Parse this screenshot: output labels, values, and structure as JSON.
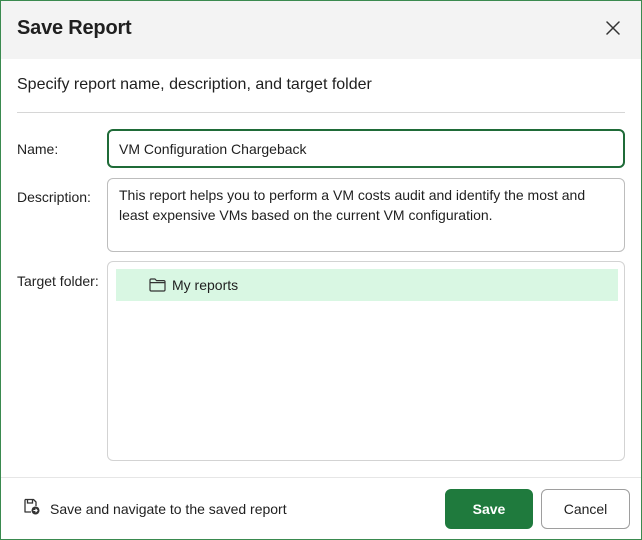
{
  "dialog": {
    "title": "Save Report",
    "subtitle": "Specify report name, description, and target folder"
  },
  "form": {
    "name_label": "Name:",
    "name_value": "VM Configuration Chargeback",
    "description_label": "Description:",
    "description_value": "This report helps you to perform a VM costs audit and identify the most and least expensive VMs based on the current VM configuration.",
    "target_folder_label": "Target folder:"
  },
  "folders": [
    {
      "label": "My reports",
      "selected": true,
      "icon": "folder-icon"
    }
  ],
  "footer": {
    "navigate_label": "Save and navigate to the saved report",
    "navigate_icon": "save-navigate-icon",
    "save_label": "Save",
    "cancel_label": "Cancel"
  },
  "colors": {
    "accent": "#1f7a3d",
    "selected_row": "#d9f7e3",
    "header_bg": "#f3f3f3"
  }
}
